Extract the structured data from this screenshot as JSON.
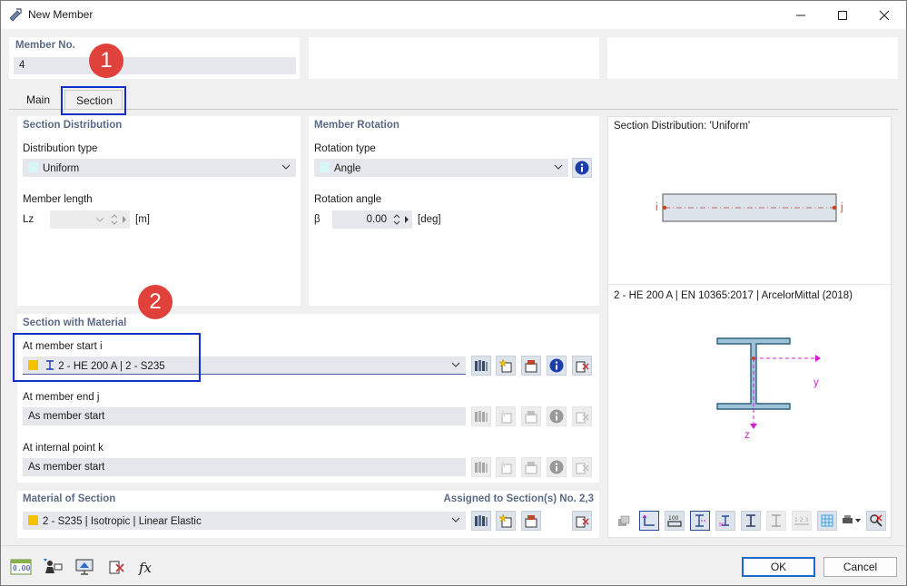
{
  "window": {
    "title": "New Member"
  },
  "member_no": {
    "label": "Member No.",
    "value": "4"
  },
  "tabs": [
    {
      "label": "Main"
    },
    {
      "label": "Section"
    }
  ],
  "section_distribution": {
    "title": "Section Distribution",
    "distribution_type_label": "Distribution type",
    "distribution_type_value": "Uniform",
    "member_length_label": "Member length",
    "lz_label": "Lz",
    "lz_unit": "[m]"
  },
  "member_rotation": {
    "title": "Member Rotation",
    "rotation_type_label": "Rotation type",
    "rotation_type_value": "Angle",
    "rotation_angle_label": "Rotation angle",
    "beta_label": "β",
    "beta_value": "0.00",
    "beta_unit": "[deg]"
  },
  "section_with_material": {
    "title": "Section with Material",
    "start_label": "At member start i",
    "start_value": "2 - HE 200 A | 2 - S235",
    "end_label": "At member end j",
    "end_value": "As member start",
    "internal_label": "At internal point k",
    "internal_value": "As member start"
  },
  "material_of_section": {
    "title": "Material of Section",
    "assigned": "Assigned to Section(s) No. 2,3",
    "value": "2 - S235 | Isotropic | Linear Elastic"
  },
  "preview": {
    "distribution_caption": "Section Distribution: 'Uniform'",
    "node_i": "i",
    "node_j": "j",
    "section_caption": "2 - HE 200 A | EN 10365:2017 | ArcelorMittal (2018)",
    "axis_y": "y",
    "axis_z": "z"
  },
  "markers": [
    "1",
    "2"
  ],
  "footer": {
    "ok": "OK",
    "cancel": "Cancel",
    "numeric_icon_text": "0.00"
  },
  "colors": {
    "accent": "#1030c8",
    "marker": "#e0413a",
    "section_yellow": "#f2c200",
    "title_blue": "#5b6b86"
  }
}
